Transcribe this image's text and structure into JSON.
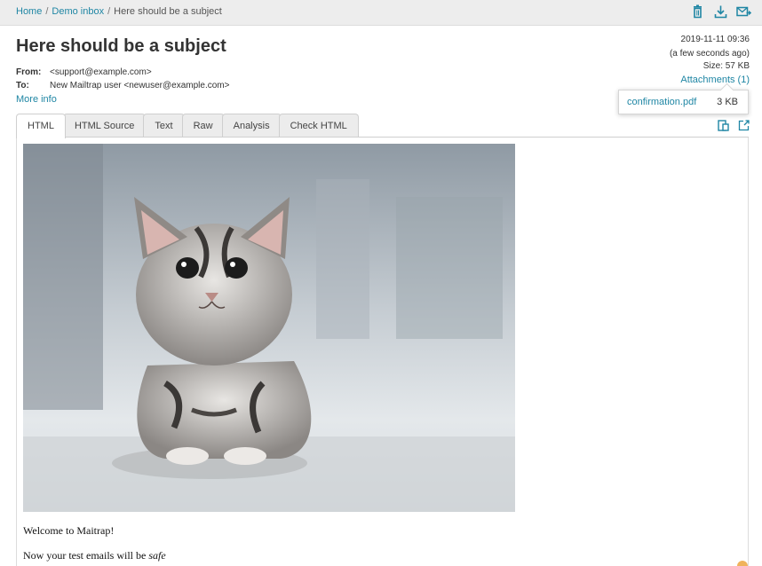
{
  "breadcrumb": {
    "home": "Home",
    "sep": "/",
    "inbox": "Demo inbox",
    "current": "Here should be a subject"
  },
  "toolbar": {
    "icons": [
      "trash-icon",
      "download-icon",
      "forward-mail-icon"
    ],
    "accent": "#1f86a4"
  },
  "message": {
    "subject": "Here should be a subject",
    "from_label": "From:",
    "from_value": "<support@example.com>",
    "to_label": "To:",
    "to_value": "New Mailtrap user <newuser@example.com>",
    "more_info": "More info",
    "datetime": "2019-11-11 09:36",
    "relative_time": "(a few seconds ago)",
    "size": "Size: 57 KB",
    "attachments_link": "Attachments (1)"
  },
  "attachment": {
    "name": "confirmation.pdf",
    "size": "3 KB"
  },
  "tabs": [
    {
      "label": "HTML",
      "active": true
    },
    {
      "label": "HTML Source",
      "active": false
    },
    {
      "label": "Text",
      "active": false
    },
    {
      "label": "Raw",
      "active": false
    },
    {
      "label": "Analysis",
      "active": false
    },
    {
      "label": "Check HTML",
      "active": false
    }
  ],
  "view_actions": {
    "icons": [
      "mobile-view-icon",
      "open-external-icon"
    ]
  },
  "email_body": {
    "welcome": "Welcome to Maitrap!",
    "line_prefix": "Now your test emails will be",
    "line_emphasis": "safe"
  }
}
